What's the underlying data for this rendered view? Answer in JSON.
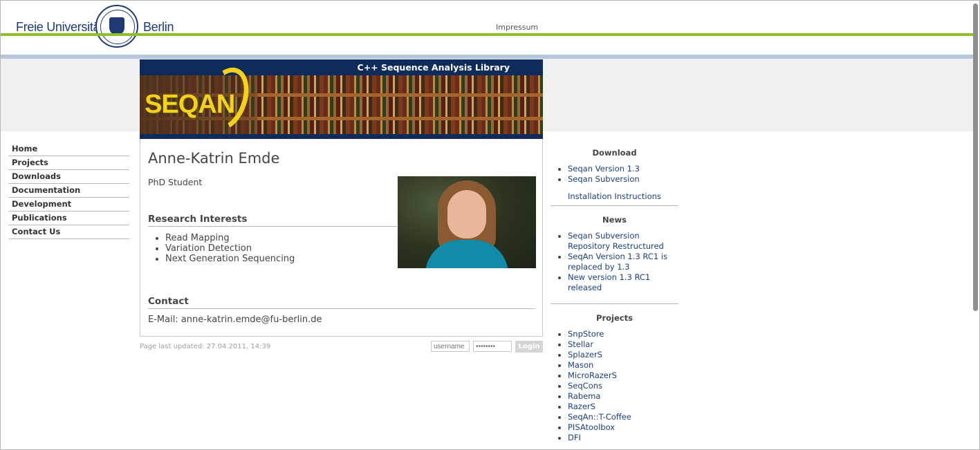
{
  "header": {
    "logo_left": "Freie Universität",
    "logo_right": "Berlin",
    "impressum": "Impressum"
  },
  "banner": {
    "tagline": "C++ Sequence Analysis Library",
    "logo_text": "SEQAN"
  },
  "nav": {
    "items": [
      "Home",
      "Projects",
      "Downloads",
      "Documentation",
      "Development",
      "Publications",
      "Contact Us"
    ]
  },
  "profile": {
    "name": "Anne-Katrin Emde",
    "role": "PhD Student",
    "research_heading": "Research Interests",
    "interests": [
      "Read Mapping",
      "Variation Detection",
      "Next Generation Sequencing"
    ],
    "contact_heading": "Contact",
    "email_line": "E-Mail: anne-katrin.emde@fu-berlin.de"
  },
  "footer": {
    "updated": "Page last updated: 27.04.2011, 14:39",
    "username_placeholder": "username",
    "password_placeholder": "••••••••",
    "login_label": "Login"
  },
  "sidebar": {
    "download_heading": "Download",
    "download_items": [
      "Seqan Version 1.3",
      "Seqan Subversion"
    ],
    "install_link": "Installation Instructions",
    "news_heading": "News",
    "news_items": [
      "Seqan Subversion Repository Restructured",
      "SeqAn Version 1.3 RC1 is replaced by 1.3",
      "New version 1.3 RC1 released"
    ],
    "projects_heading": "Projects",
    "project_items": [
      "SnpStore",
      "Stellar",
      "SplazerS",
      "Mason",
      "MicroRazerS",
      "SeqCons",
      "Rabema",
      "RazerS",
      "SeqAn::T-Coffee",
      "PISAtoolbox",
      "DFI"
    ]
  }
}
